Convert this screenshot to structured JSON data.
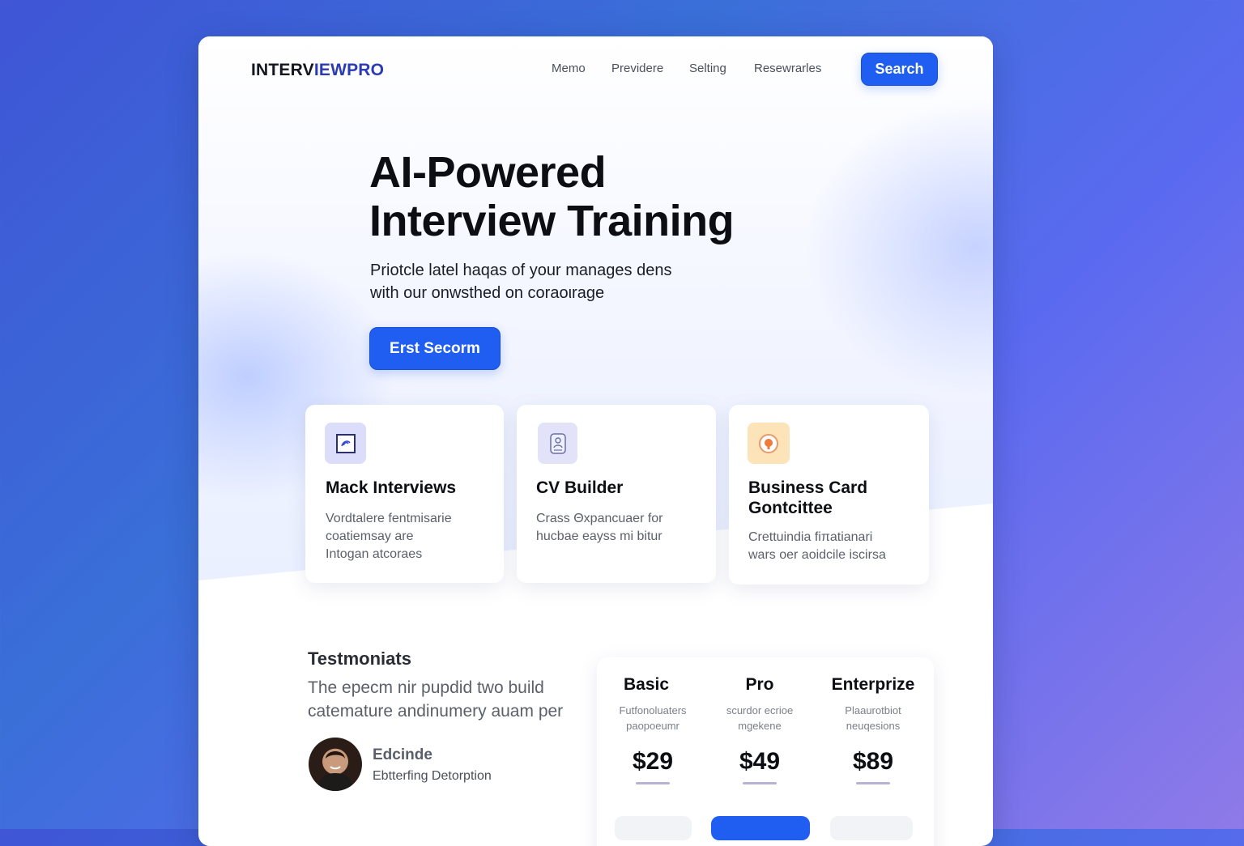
{
  "brand": {
    "part1": "INTERV",
    "part2": "IEWPRO"
  },
  "nav": {
    "items": [
      "Memo",
      "Previdere",
      "Selting",
      "Resewrarles"
    ],
    "search_label": "Search"
  },
  "hero": {
    "title_line1": "AI-Powered",
    "title_line2": "Interview Training",
    "subtitle_line1": "Priotcle latel haqas of your manages dens",
    "subtitle_line2": "with our onwsthed on coraoιrage",
    "cta_label": "Erst Secorm"
  },
  "features": [
    {
      "icon": "interview-icon",
      "title": "Mack Interviews",
      "desc_lines": [
        "Vordtalere fentmisarie",
        "coatiemsay are",
        "Intogan atcoraes"
      ]
    },
    {
      "icon": "cv-icon",
      "title": "CV Builder",
      "desc_lines": [
        "Crass Θxpancuaer for",
        "hucbae eayss mi bitur"
      ]
    },
    {
      "icon": "business-card-icon",
      "title": "Business Card Gontcittee",
      "desc_lines": [
        "Crettuindia fiπatianari",
        "wars oer aoidcile iscirsa"
      ]
    }
  ],
  "testimonials": {
    "title": "Testmoniats",
    "quote_line1": "The epecm nir pupdid two build",
    "quote_line2": "catemature andinumery auam per",
    "name": "Edcinde",
    "role": "Ebtterfing Detorption"
  },
  "pricing": {
    "plans": [
      {
        "name": "Basic",
        "desc_line1": "Futfonoluaters",
        "desc_line2": "paopoeumr",
        "price": "$29"
      },
      {
        "name": "Pro",
        "desc_line1": "scurdor ecrioe",
        "desc_line2": "mgekene",
        "price": "$49"
      },
      {
        "name": "Enterprize",
        "desc_line1": "Plaaurotbiot",
        "desc_line2": "neuqesions",
        "price": "$89"
      }
    ]
  },
  "colors": {
    "accent": "#1f5ef0",
    "brand_secondary": "#2b3bb8",
    "background_start": "#3f55d6",
    "background_end": "#8f7ae8"
  }
}
